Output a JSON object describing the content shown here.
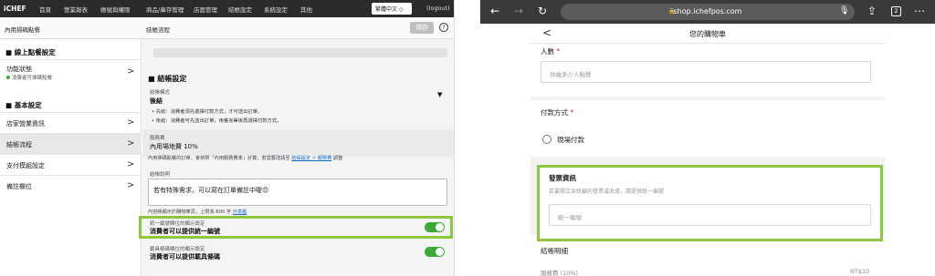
{
  "admin": {
    "logo": "iCHEF",
    "nav": [
      "首頁",
      "營業報表",
      "帳號與權限",
      "商品/庫存管理",
      "店面管理",
      "結帳設定",
      "系統設定",
      "其他"
    ],
    "language": "繁體中文 ◇",
    "logout": "(logout)",
    "left_panel_title": "內用掃碼點餐",
    "right_panel_title": "結帳流程",
    "save_label": "儲存",
    "help_symbol": "?",
    "sidebar": {
      "section_online": "■ 線上點餐設定",
      "status_label": "功能狀態",
      "status_sub": "消費者可掃碼點餐",
      "section_basic": "■ 基本設定",
      "items": [
        "店家營業資訊",
        "結帳流程",
        "支付模組設定",
        "備註欄位"
      ],
      "chevron": ">"
    },
    "checkout": {
      "heading": "■ 結帳設定",
      "mode_label": "結帳模式",
      "mode_value": "後結",
      "mode_caret": "▼",
      "bullet_1": "• 先結：消費者須先選擇付款方式，才可送出訂單。",
      "bullet_2": "• 後結：消費者可先送出訂單，用餐完畢後再選擇付款方式。",
      "service_label": "服務費",
      "service_value": "內用場地費 10%",
      "service_note_pre": "內用掃碼點餐的訂單，會依照「內用服務費率」計算，若需要改請至",
      "service_note_link": "結帳設定 > 服務費",
      "service_note_post": "調整",
      "desc_label": "結帳說明",
      "desc_text": "若有特殊需求，可以寫在訂單備註中喔😉",
      "desc_note_pre": "內容將顯示於購物車頁，上限為 600 字",
      "desc_note_link": "示意圖",
      "tax_label_sm": "統一編號欄位的顯示設定",
      "tax_label": "消費者可以提供統一編號",
      "carrier_label_sm": "載具條碼欄位的顯示設定",
      "carrier_label": "消費者可以提供載具條碼"
    }
  },
  "mobile": {
    "url": "shop.ichefpos.com",
    "lock_icon": "🔒",
    "back_symbol": "←",
    "forward_symbol": "→",
    "reload_symbol": "↻",
    "mic_symbol": "🎙",
    "share_symbol": "⇪",
    "tab_count": "2",
    "menu_symbol": "⋯",
    "page_back": "<",
    "page_title": "您的購物車",
    "people_label": "人數",
    "required_mark": "*",
    "people_placeholder": "你幾多少人點餐",
    "payment_label": "付款方式",
    "payment_option": "現場付款",
    "invoice_title": "發票資訊",
    "invoice_hint": "若要開立含統編的發票或收據，請提供統一編號",
    "invoice_placeholder": "統一編號",
    "summary_title": "結帳明細",
    "summary_peek_left": "服務費 (10%)",
    "summary_peek_right": "NT$10"
  }
}
